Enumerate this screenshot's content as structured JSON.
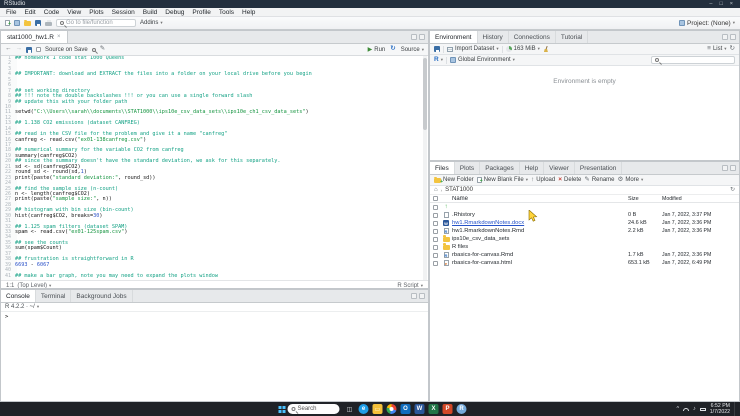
{
  "icons": {
    "house": "⌂",
    "refresh": "↻",
    "list": "≡",
    "caret": "▾",
    "up_arrow": "↑",
    "run": "▶",
    "back": "←",
    "forward": "→",
    "rerun": "↻",
    "close": "×",
    "chevron_up": "^",
    "min": "–",
    "max": "□",
    "crumb_sep": "›"
  },
  "titlebar": {
    "title": "RStudio"
  },
  "menu": {
    "items": [
      "File",
      "Edit",
      "Code",
      "View",
      "Plots",
      "Session",
      "Build",
      "Debug",
      "Profile",
      "Tools",
      "Help"
    ]
  },
  "toolbar": {
    "goto_placeholder": "Go to file/function",
    "addins_label": "Addins",
    "project_label": "Project: (None)"
  },
  "source": {
    "tab_label": "stat1000_hw1.R",
    "source_on_save": "Source on Save",
    "run_label": "Run",
    "source_label": "Source",
    "status_pos": "1:1",
    "status_scope": "(Top Level)",
    "status_type": "R Script",
    "lines": [
      {
        "s": [
          [
            "com",
            "## homework 1 code stat 1000 Queens"
          ]
        ]
      },
      {
        "s": []
      },
      {
        "s": []
      },
      {
        "s": [
          [
            "com",
            "## IMPORTANT: download and EXTRACT the files into a folder on your local drive before you begin"
          ]
        ]
      },
      {
        "s": []
      },
      {
        "s": []
      },
      {
        "s": [
          [
            "com",
            "## set working directory"
          ]
        ]
      },
      {
        "s": [
          [
            "com",
            "## !!! note the double backslashes !!! or you can use a single forward slash"
          ]
        ]
      },
      {
        "s": [
          [
            "com",
            "## update this with your folder path"
          ]
        ]
      },
      {
        "s": []
      },
      {
        "s": [
          [
            "txt",
            "setwd("
          ],
          [
            "str",
            "\"C:\\\\Users\\\\sarah\\\\documents\\\\STAT1000\\\\ips10e_csv_data_sets\\\\ips10e_ch1_csv_data_sets\""
          ],
          [
            "txt",
            ")"
          ]
        ]
      },
      {
        "s": []
      },
      {
        "s": [
          [
            "com",
            "## 1.138 CO2 emissions (dataset CANFREG)"
          ]
        ]
      },
      {
        "s": []
      },
      {
        "s": [
          [
            "com",
            "## read in the CSV file for the problem and give it a name \"canfreg\""
          ]
        ]
      },
      {
        "s": [
          [
            "txt",
            "canfreg <- read.csv("
          ],
          [
            "str",
            "\"ex01-138canfreg.csv\""
          ],
          [
            "txt",
            ")"
          ]
        ]
      },
      {
        "s": []
      },
      {
        "s": [
          [
            "com",
            "## numerical summary for the variable CO2 from canfreg"
          ]
        ]
      },
      {
        "s": [
          [
            "txt",
            "summary(canfreg$CO2)"
          ]
        ]
      },
      {
        "s": [
          [
            "com",
            "## since the summary doesn't have the standard deviation, we ask for this separately."
          ]
        ]
      },
      {
        "s": [
          [
            "txt",
            "sd <- sd(canfreg$CO2)"
          ]
        ]
      },
      {
        "s": [
          [
            "txt",
            "round_sd <- round(sd,"
          ],
          [
            "num",
            "1"
          ],
          [
            "txt",
            ")"
          ]
        ]
      },
      {
        "s": [
          [
            "txt",
            "print(paste("
          ],
          [
            "str",
            "\"standard deviation:\""
          ],
          [
            "txt",
            ", round_sd))"
          ]
        ]
      },
      {
        "s": []
      },
      {
        "s": [
          [
            "com",
            "## find the sample size (n-count)"
          ]
        ]
      },
      {
        "s": [
          [
            "txt",
            "n <- length(canfreg$CO2)"
          ]
        ]
      },
      {
        "s": [
          [
            "txt",
            "print(paste("
          ],
          [
            "str",
            "\"sample size:\""
          ],
          [
            "txt",
            ", n))"
          ]
        ]
      },
      {
        "s": []
      },
      {
        "s": [
          [
            "com",
            "## histogram with bin size (bin-count)"
          ]
        ]
      },
      {
        "s": [
          [
            "txt",
            "hist(canfreg$CO2, breaks="
          ],
          [
            "num",
            "30"
          ],
          [
            "txt",
            ")"
          ]
        ]
      },
      {
        "s": []
      },
      {
        "s": [
          [
            "com",
            "## 1.125 spam filters (dataset SPAM)"
          ]
        ]
      },
      {
        "s": [
          [
            "txt",
            "spam <- read.csv("
          ],
          [
            "str",
            "\"ex01-125spam.csv\""
          ],
          [
            "txt",
            ")"
          ]
        ]
      },
      {
        "s": []
      },
      {
        "s": [
          [
            "com",
            "## see the counts"
          ]
        ]
      },
      {
        "s": [
          [
            "txt",
            "sum(spam$Count)"
          ]
        ]
      },
      {
        "s": []
      },
      {
        "s": [
          [
            "com",
            "## frustration is straightforward in R"
          ]
        ]
      },
      {
        "s": [
          [
            "num",
            "6693"
          ],
          [
            "txt",
            " - "
          ],
          [
            "num",
            "6067"
          ]
        ]
      },
      {
        "s": []
      },
      {
        "s": [
          [
            "com",
            "## make a bar graph, note you may need to expand the plots window"
          ]
        ]
      }
    ]
  },
  "console": {
    "tabs": [
      "Console",
      "Terminal",
      "Background Jobs"
    ],
    "selected": "Console",
    "version_line": "R 4.2.2 · ~/",
    "prompt": ">"
  },
  "environment": {
    "tabs": [
      "Environment",
      "History",
      "Connections",
      "Tutorial"
    ],
    "selected": "Environment",
    "import_label": "Import Dataset",
    "memory_label": "163 MiB",
    "list_label": "List",
    "lang_label": "R",
    "scope_label": "Global Environment",
    "empty_text": "Environment is empty"
  },
  "files": {
    "tabs": [
      "Files",
      "Plots",
      "Packages",
      "Help",
      "Viewer",
      "Presentation"
    ],
    "selected": "Files",
    "toolbar": [
      {
        "label": "New Folder",
        "icon": "folderplus",
        "caret": false
      },
      {
        "label": "New Blank File",
        "icon": "pageplus",
        "caret": true
      },
      {
        "label": "Upload",
        "icon": "upload",
        "caret": false
      },
      {
        "label": "Delete",
        "icon": "delete",
        "caret": false
      },
      {
        "label": "Rename",
        "icon": "rename",
        "caret": false
      },
      {
        "label": "More",
        "icon": "gear",
        "caret": true
      }
    ],
    "breadcrumb_label": "STAT1000",
    "columns": [
      "Name",
      "Size",
      "Modified"
    ],
    "rows": [
      {
        "icon": "up",
        "name": "",
        "size": "",
        "modified": "",
        "link": false
      },
      {
        "icon": "file",
        "name": ".Rhistory",
        "size": "0 B",
        "modified": "Jan 7, 2022, 3:37 PM",
        "link": false
      },
      {
        "icon": "word",
        "name": "hw1.RmarkdownNotes.docx",
        "size": "24.6 kB",
        "modified": "Jan 7, 2022, 3:36 PM",
        "link": true
      },
      {
        "icon": "rmd",
        "name": "hw1.RmarkdownNotes.Rmd",
        "size": "2.2 kB",
        "modified": "Jan 7, 2022, 3:36 PM",
        "link": false
      },
      {
        "icon": "folder",
        "name": "ips10e_csv_data_sets",
        "size": "",
        "modified": "",
        "link": false
      },
      {
        "icon": "folder",
        "name": "R files",
        "size": "",
        "modified": "",
        "link": false
      },
      {
        "icon": "rmd",
        "name": "rbasics-for-canvas.Rmd",
        "size": "1.7 kB",
        "modified": "Jan 7, 2022, 3:36 PM",
        "link": false
      },
      {
        "icon": "html",
        "name": "rbasics-for-canvas.html",
        "size": "653.1 kB",
        "modified": "Jan 7, 2022, 6:49 PM",
        "link": false
      }
    ]
  },
  "taskbar": {
    "search_label": "Search",
    "time": "6:52 PM",
    "date": "1/7/2022",
    "icons": [
      {
        "name": "task-view-icon",
        "glyph": "◫",
        "bg": "transparent",
        "fg": "#d6dadf",
        "round": false
      },
      {
        "name": "edge-icon",
        "glyph": "e",
        "bg": "#1e9de6",
        "fg": "#ffffff",
        "round": true
      },
      {
        "name": "file-explorer-icon",
        "glyph": "▭",
        "bg": "#f5c13a",
        "fg": "#fff8e0",
        "round": false
      },
      {
        "name": "chrome-icon",
        "glyph": "",
        "bg": "chrome",
        "fg": "#ffffff",
        "round": true
      },
      {
        "name": "outlook-icon",
        "glyph": "O",
        "bg": "#0f6cbd",
        "fg": "#ffffff",
        "round": false
      },
      {
        "name": "word-icon",
        "glyph": "W",
        "bg": "#2b579a",
        "fg": "#ffffff",
        "round": false
      },
      {
        "name": "excel-icon",
        "glyph": "X",
        "bg": "#217346",
        "fg": "#ffffff",
        "round": false
      },
      {
        "name": "powerpoint-icon",
        "glyph": "P",
        "bg": "#d24726",
        "fg": "#ffffff",
        "round": false
      },
      {
        "name": "rstudio-icon",
        "glyph": "R",
        "bg": "#75aadb",
        "fg": "#ffffff",
        "round": true
      }
    ]
  }
}
